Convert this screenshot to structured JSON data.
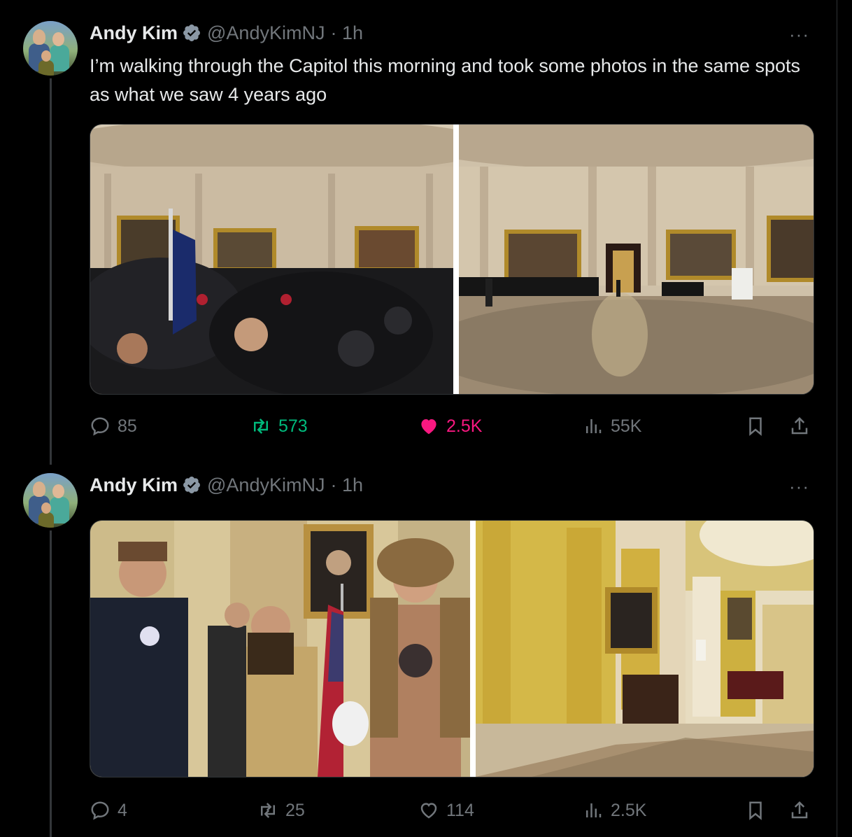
{
  "tweets": [
    {
      "author": {
        "name": "Andy Kim",
        "handle": "@AndyKimNJ",
        "time": "· 1h"
      },
      "text": "I’m walking through the Capitol this morning and took some photos in the same spots as what we saw 4 years ago",
      "more_label": "···",
      "media": [
        {
          "icon": "crowd-in-rotunda-photo"
        },
        {
          "icon": "empty-rotunda-photo"
        }
      ],
      "actions": {
        "replies": "85",
        "reposts": "573",
        "likes": "2.5K",
        "views": "55K",
        "liked": true
      }
    },
    {
      "author": {
        "name": "Andy Kim",
        "handle": "@AndyKimNJ",
        "time": "· 1h"
      },
      "text": "",
      "more_label": "···",
      "media": [
        {
          "icon": "rioters-in-hallway-photo"
        },
        {
          "icon": "empty-hallway-photo"
        }
      ],
      "actions": {
        "replies": "4",
        "reposts": "25",
        "likes": "114",
        "views": "2.5K",
        "liked": false
      }
    }
  ],
  "colors": {
    "background": "#000000",
    "text": "#e7e9ea",
    "muted": "#71767b",
    "repost": "#00ba7c",
    "like": "#f91880",
    "verified": "#8b98a5"
  }
}
